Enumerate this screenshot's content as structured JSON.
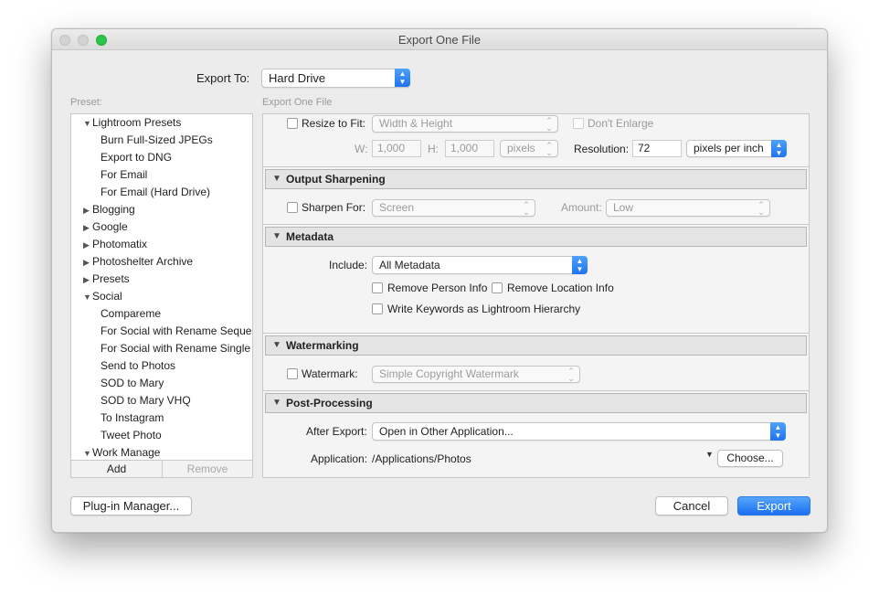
{
  "window": {
    "title": "Export One File"
  },
  "export_to": {
    "label": "Export To:",
    "value": "Hard Drive"
  },
  "preset_label": "Preset:",
  "panel_label": "Export One File",
  "presets": [
    {
      "label": "Lightroom Presets",
      "expanded": true,
      "level": 0
    },
    {
      "label": "Burn Full-Sized JPEGs",
      "level": 1
    },
    {
      "label": "Export to DNG",
      "level": 1
    },
    {
      "label": "For Email",
      "level": 1
    },
    {
      "label": "For Email (Hard Drive)",
      "level": 1
    },
    {
      "label": "Blogging",
      "expanded": false,
      "level": 0
    },
    {
      "label": "Google",
      "expanded": false,
      "level": 0
    },
    {
      "label": "Photomatix",
      "expanded": false,
      "level": 0
    },
    {
      "label": "Photoshelter Archive",
      "expanded": false,
      "level": 0
    },
    {
      "label": "Presets",
      "expanded": false,
      "level": 0
    },
    {
      "label": "Social",
      "expanded": true,
      "level": 0
    },
    {
      "label": "Compareme",
      "level": 1
    },
    {
      "label": "For Social with Rename Sequen",
      "level": 1
    },
    {
      "label": "For Social with Rename Single",
      "level": 1
    },
    {
      "label": "Send to Photos",
      "level": 1
    },
    {
      "label": "SOD to Mary",
      "level": 1
    },
    {
      "label": "SOD to Mary VHQ",
      "level": 1
    },
    {
      "label": "To Instagram",
      "level": 1
    },
    {
      "label": "Tweet Photo",
      "level": 1
    },
    {
      "label": "Work Manage",
      "expanded": true,
      "level": 0
    }
  ],
  "preset_buttons": {
    "add": "Add",
    "remove": "Remove"
  },
  "image_sizing": {
    "resize_label": "Resize to Fit:",
    "resize_mode": "Width & Height",
    "dont_enlarge": "Don't Enlarge",
    "w_label": "W:",
    "w_value": "1,000",
    "h_label": "H:",
    "h_value": "1,000",
    "units": "pixels",
    "resolution_label": "Resolution:",
    "resolution_value": "72",
    "resolution_units": "pixels per inch"
  },
  "output_sharpening": {
    "title": "Output Sharpening",
    "sharpen_label": "Sharpen For:",
    "sharpen_value": "Screen",
    "amount_label": "Amount:",
    "amount_value": "Low"
  },
  "metadata": {
    "title": "Metadata",
    "include_label": "Include:",
    "include_value": "All Metadata",
    "remove_person": "Remove Person Info",
    "remove_location": "Remove Location Info",
    "write_keywords": "Write Keywords as Lightroom Hierarchy"
  },
  "watermarking": {
    "title": "Watermarking",
    "watermark_label": "Watermark:",
    "watermark_value": "Simple Copyright Watermark"
  },
  "post_processing": {
    "title": "Post-Processing",
    "after_label": "After Export:",
    "after_value": "Open in Other Application...",
    "app_label": "Application:",
    "app_value": "/Applications/Photos",
    "choose": "Choose..."
  },
  "footer": {
    "plugin_manager": "Plug-in Manager...",
    "cancel": "Cancel",
    "export": "Export"
  },
  "colors": {
    "accent": "#1f73f0",
    "close": "#d3d3d3",
    "zoom": "#2ac64a"
  }
}
